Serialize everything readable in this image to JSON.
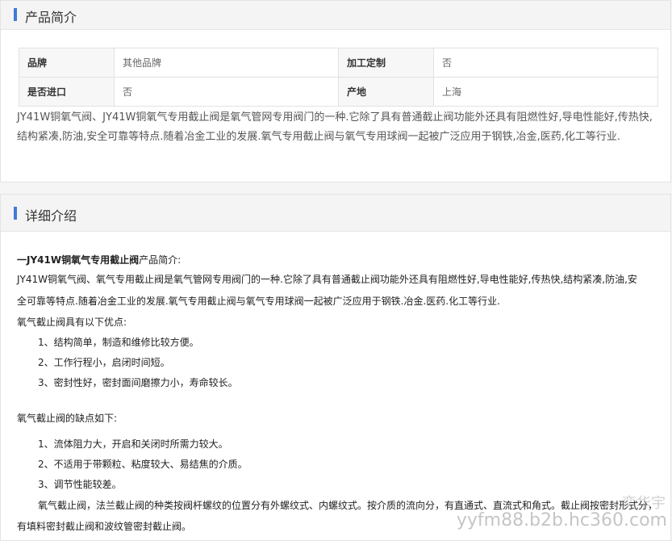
{
  "intro_section": {
    "title": "产品简介",
    "specs": [
      {
        "label": "品牌",
        "value": "其他品牌"
      },
      {
        "label": "加工定制",
        "value": "否"
      },
      {
        "label": "是否进口",
        "value": "否"
      },
      {
        "label": "产地",
        "value": "上海"
      }
    ],
    "description": "JY41W铜氧气阀、JY41W铜氧气专用截止阀是氧气管网专用阀门的一种.它除了具有普通截止阀功能外还具有阻燃性好,导电性能好,传热快,结构紧凑,防油,安全可靠等特点.随着冶金工业的发展.氧气专用截止阀与氧气专用球阀一起被广泛应用于钢铁,冶金,医药,化工等行业."
  },
  "detail_section": {
    "title": "详细介绍",
    "heading_bold": "一JY41W铜氧气专用截止阀",
    "heading_rest": "产品简介:",
    "para_line1": "JY41W铜氧气阀、氧气专用截止阀是氧气管网专用阀门的一种.它除了具有普通截止阀功能外还具有阻燃性好,导电性能好,传热快,结构紧凑,防油,安",
    "para_line2": "全可靠等特点.随着冶金工业的发展.氧气专用截止阀与氧气专用球阀一起被广泛应用于钢铁.冶金.医药.化工等行业.",
    "advantages_title": "氧气截止阀具有以下优点:",
    "advantages": [
      "1、结构简单，制造和维修比较方便。",
      "2、工作行程小，启闭时间短。",
      "3、密封性好，密封面间磨擦力小，寿命较长。"
    ],
    "disadvantages_title": "氧气截止阀的缺点如下:",
    "disadvantages": [
      "1、流体阻力大，开启和关闭时所需力较大。",
      "2、不适用于带颗粒、粘度较大、易结焦的介质。",
      "3、调节性能较差。"
    ],
    "types_line1": "氧气截止阀，法兰截止阀的种类按阀杆螺纹的位置分有外螺纹式、内螺纹式。按介质的流向分，有直通式、直流式和角式。截止阀按密封形式分，",
    "types_line2": "有填料密封截止阀和波纹管密封截止阀。"
  },
  "watermark": {
    "brand": "奕华宇",
    "url": "yyfm88.b2b.hc360.com"
  }
}
